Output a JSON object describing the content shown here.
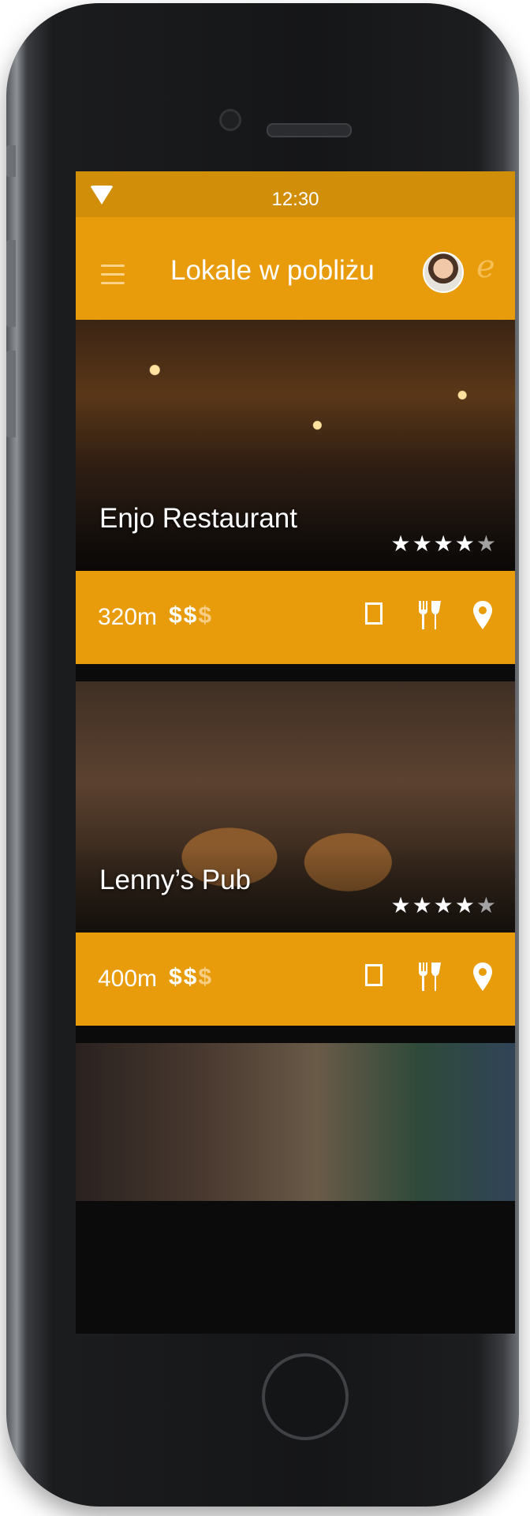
{
  "status": {
    "time": "12:30"
  },
  "appbar": {
    "title": "Lokale w pobliżu"
  },
  "venues": [
    {
      "name": "Enjo Restaurant",
      "distance": "320m",
      "price_active": "$$",
      "price_inactive": "$",
      "rating": 4,
      "rating_max": 5
    },
    {
      "name": "Lenny’s Pub",
      "distance": "400m",
      "price_active": "$$",
      "price_inactive": "$",
      "rating": 4,
      "rating_max": 5
    }
  ],
  "colors": {
    "accent": "#e89c0b",
    "status": "#d18e08"
  },
  "icons": [
    "wifi-icon",
    "battery-icon",
    "hamburger-menu-icon",
    "menu-book-icon",
    "cutlery-icon",
    "map-pin-icon",
    "star-icon"
  ]
}
